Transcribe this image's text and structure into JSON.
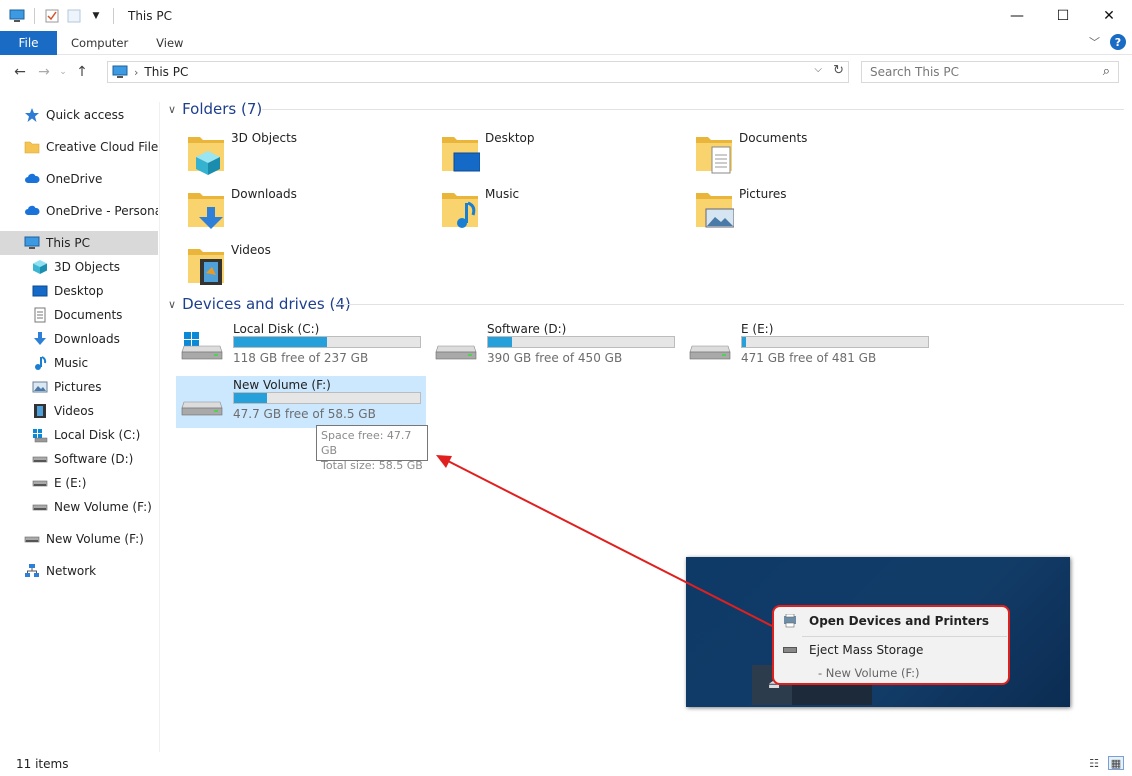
{
  "window": {
    "title": "This PC",
    "minimize": "—",
    "maximize": "☐",
    "close": "✕"
  },
  "ribbon": {
    "file": "File",
    "tabs": [
      "Computer",
      "View"
    ]
  },
  "address": {
    "crumb": "This PC"
  },
  "search": {
    "placeholder": "Search This PC"
  },
  "sidebar": {
    "items": [
      {
        "label": "Quick access",
        "icon": "star-icon"
      },
      {
        "label": "Creative Cloud Files P",
        "icon": "folder-icon"
      },
      {
        "label": "OneDrive",
        "icon": "cloud-icon"
      },
      {
        "label": "OneDrive - Personal",
        "icon": "cloud-icon"
      },
      {
        "label": "This PC",
        "icon": "computer-icon",
        "selected": true
      },
      {
        "label": "3D Objects",
        "icon": "cube-icon"
      },
      {
        "label": "Desktop",
        "icon": "desktop-icon"
      },
      {
        "label": "Documents",
        "icon": "document-icon"
      },
      {
        "label": "Downloads",
        "icon": "download-icon"
      },
      {
        "label": "Music",
        "icon": "music-icon"
      },
      {
        "label": "Pictures",
        "icon": "picture-icon"
      },
      {
        "label": "Videos",
        "icon": "film-icon"
      },
      {
        "label": "Local Disk (C:)",
        "icon": "windows-drive-icon"
      },
      {
        "label": "Software (D:)",
        "icon": "drive-icon"
      },
      {
        "label": "E (E:)",
        "icon": "drive-icon"
      },
      {
        "label": "New Volume (F:)",
        "icon": "drive-icon"
      },
      {
        "label": "New Volume (F:)",
        "icon": "drive-icon"
      },
      {
        "label": "Network",
        "icon": "network-icon"
      }
    ]
  },
  "folders": {
    "header": "Folders (7)",
    "items": [
      {
        "name": "3D Objects",
        "icon": "cube-icon"
      },
      {
        "name": "Desktop",
        "icon": "desktop-icon"
      },
      {
        "name": "Documents",
        "icon": "document-icon"
      },
      {
        "name": "Downloads",
        "icon": "download-icon"
      },
      {
        "name": "Music",
        "icon": "music-icon"
      },
      {
        "name": "Pictures",
        "icon": "picture-icon"
      },
      {
        "name": "Videos",
        "icon": "film-icon"
      }
    ]
  },
  "drives": {
    "header": "Devices and drives (4)",
    "items": [
      {
        "name": "Local Disk (C:)",
        "free": "118 GB free of 237 GB",
        "used_fraction": 0.5
      },
      {
        "name": "Software (D:)",
        "free": "390 GB free of 450 GB",
        "used_fraction": 0.13
      },
      {
        "name": "E (E:)",
        "free": "471 GB free of 481 GB",
        "used_fraction": 0.02
      },
      {
        "name": "New Volume (F:)",
        "free": "47.7 GB free of 58.5 GB",
        "used_fraction": 0.18
      }
    ]
  },
  "tooltip": {
    "line1": "Space free: 47.7 GB",
    "line2": "Total size: 58.5 GB"
  },
  "context_menu": {
    "open": "Open Devices and Printers",
    "eject": "Eject Mass Storage",
    "eject_sub": "-   New Volume (F:)"
  },
  "status": {
    "count": "11 items"
  },
  "colors": {
    "accent": "#1a6bc4",
    "bar_fill": "#26a0da",
    "annotation": "#e0201f"
  }
}
